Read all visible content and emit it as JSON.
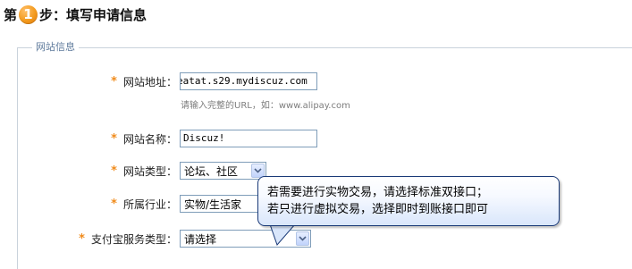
{
  "header": {
    "prefix": "第",
    "step_number": "1",
    "suffix": "步：填写申请信息"
  },
  "fieldset": {
    "legend": "网站信息"
  },
  "form": {
    "site_url": {
      "label": "网站地址：",
      "value": "eatat.s29.mydiscuz.com",
      "hint": "请输入完整的URL，如：www.alipay.com"
    },
    "site_name": {
      "label": "网站名称：",
      "value": "Discuz!"
    },
    "site_type": {
      "label": "网站类型：",
      "selected": "论坛、社区"
    },
    "industry": {
      "label": "所属行业：",
      "selected": "实物/生活家"
    },
    "alipay_service_type": {
      "label": "支付宝服务类型：",
      "selected": "请选择"
    },
    "required_mark": "*"
  },
  "tooltip": {
    "line1": "若需要进行实物交易，请选择标准双接口；",
    "line2": "若只进行虚拟交易，选择即时到账接口即可"
  },
  "colors": {
    "accent_orange": "#f08b1b",
    "legend_blue": "#5f7b9c",
    "input_border": "#7f9db9",
    "tooltip_border": "#1a3a78"
  }
}
